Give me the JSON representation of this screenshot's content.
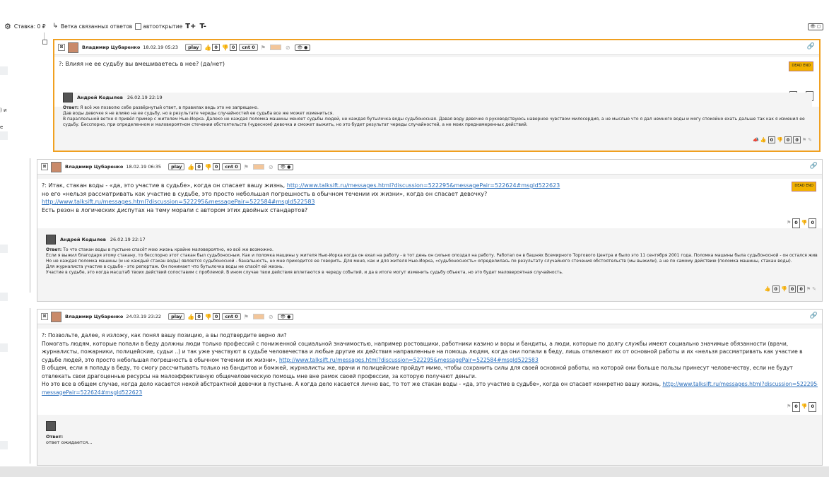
{
  "toolbar": {
    "stake_label": "Ставка: 0 ₽",
    "branch_label": "Ветка связанных ответов",
    "autoopen_label": "автооткрытие",
    "font_plus": "T+",
    "font_minus": "T-",
    "toggle": "👁 ▢"
  },
  "left_fragments": [
    ") и",
    "е"
  ],
  "accent_color": "#f0a020",
  "threads": [
    {
      "author": "Владимир Цубаренко",
      "date": "18.02.19 05:23",
      "play": "play",
      "likes": "0",
      "dislikes": "0",
      "cnt": "cnt 0",
      "question": [
        {
          "t": "?: Влияя не ее судьбу вы вмешиваетесь в нее? (да/нет)"
        }
      ],
      "badge": "DEAD END",
      "qvotes": [
        "0",
        "0"
      ],
      "answer_author": "Андрей Кодылев",
      "answer_date": "26.02.19 22:19",
      "answer_label": "Ответ:",
      "answer_lines": [
        "Я всё же позволю себе развёрнутый ответ, в правилах ведь это не запрещено.",
        "Дав воды девочке я не влияю на ее судьбу, но в результате череды случайностей ее судьба все же может измениться.",
        "В параллельной ветке я привёл пример с жителем Нью-Йорка. Далеко не каждая поломка машины меняет судьбы людей, не каждая бутылочка воды судьбоносная. Давая воду девочке я руководствуюсь наверное чувством милосердия, а не мыслью что я дал немного воды и могу спокойно ехать дальше так как я изменил ее",
        "судьбу. Бесспорно, при определенном и маловероятном стечении обстоятельств (чудесном) девочка и сможет выжить, но это будет результат череды случайностей, а не моих преднамеренных действий."
      ],
      "avotes": [
        "0",
        "0",
        "0"
      ]
    },
    {
      "author": "Владимир Цубаренко",
      "date": "18.02.19 06:35",
      "play": "play",
      "likes": "0",
      "dislikes": "0",
      "cnt": "cnt 0",
      "question": [
        {
          "t": "?: Итак, стакан воды - «да, это участие в судьбе», когда он спасает вашу жизнь, ",
          "link": "http://www.talksift.ru/messages.html?discussion=522295&messagePair=522624#msgId522623"
        },
        {
          "t": "но его «нельзя рассматривать как участие в судьбе, это просто небольшая погрешность в обычном течении их жизни», когда он спасает девочку?"
        },
        {
          "t": "",
          "link": "http://www.talksift.ru/messages.html?discussion=522295&messagePair=522584#msgId522583"
        },
        {
          "t": "Есть резон в логических диспутах на тему морали с автором этих двойных стандартов?"
        }
      ],
      "badge": "DEAD END",
      "qvotes": [
        "0",
        "0"
      ],
      "answer_author": "Андрей Кодылев",
      "answer_date": "26.02.19 22:17",
      "answer_label": "Ответ:",
      "answer_lines": [
        "То что стакан воды в пустыне спасёт мою жизнь крайне маловероятно, но всё же возможно.",
        "Если я выжил благодаря этому стакану, то бесспорно этот стакан был судьбоносным. Как и поломка машины у жителя Нью-Йорка когда он ехал на работу - в тот день он сильно опоздал на работу. Работал он в башнях Всемирного Торгового Центра и было это 11 сентября 2001 года. Поломка машины была судьбоносной - он остался жив.",
        "Но не каждая поломка машины (и не каждый стакан воды) является судьбоносной - банальность, но мне приходится ее говорить. Для меня, как и для жителя Нью-Йорка, «судьбоносность» определилась по результату случайного стечения обстоятельств (мы выжили), а не по самому действию (поломка машины, стакан воды).",
        "Для журналиста участие в судьбе - это репортаж. Он понимает что бутылочка воды не спасёт ей жизнь.",
        "Участие в судьбе, это когда масштаб твоих действий сопоставим с проблемой. В ином случае твои действия вплетаются в череду событий, и да в итоге могут изменить судьбу объекта, но это будет маловероятная случайность."
      ],
      "avotes": [
        "0",
        "0",
        "0"
      ]
    },
    {
      "author": "Владимир Цубаренко",
      "date": "24.03.19 23:22",
      "play": "play",
      "likes": "0",
      "dislikes": "0",
      "cnt": "cnt 0",
      "question": [
        {
          "t": "?: Позвольте, далее, я изложу, как понял вашу позицию, а вы подтвердите верно ли?"
        },
        {
          "t": "Помогать людям, которые попали в беду должны люди только профессий с пониженной социальной значимостью, например ростовщики, работники казино и воры и бандиты, а люди, которые по долгу службы имеют социально значимые обязанности (врачи,"
        },
        {
          "t": "журналисты, пожарники, полицейские, судьи ..) и так уже участвуют в судьбе человечества и любые другие их действия направленные на помощь людям, когда они попали в беду, лишь отвлекают их от основной работы и их «нельзя рассматривать как участие в"
        },
        {
          "t": "судьбе людей, это просто небольшая погрешность в обычном течении их жизни», ",
          "link": "http://www.talksift.ru/messages.html?discussion=522295&messagePair=522584#msgId522583"
        },
        {
          "t": "В общем, если я попаду в беду, то смогу рассчитывать только на бандитов и бомжей, журналисты же, врачи и полицейские пройдут мимо, чтобы сохранить силы для своей основной работы, на которой они больше пользы принесут человечеству, если не будут"
        },
        {
          "t": "отвлекать свои драгоценные ресурсы на малоэффективную общечеловеческую помощь мне вне рамок своей профессии, за которую получают деньги."
        },
        {
          "t": "Но это все в общем случае, когда дело касается некой абстрактной девочки в пустыне. А когда дело касается лично вас, то тот же стакан воды - «да, это участие в судьбе», когда он спасает конкретно вашу жизнь, ",
          "link": "http://www.talksift.ru/messages.html?discussion=522295&"
        },
        {
          "t": "",
          "link": "messagePair=522624#msgId522623"
        }
      ],
      "qvotes": [
        "0",
        "0"
      ],
      "answer_label": "Ответ:",
      "answer_pending": "ответ ожидается..."
    }
  ]
}
